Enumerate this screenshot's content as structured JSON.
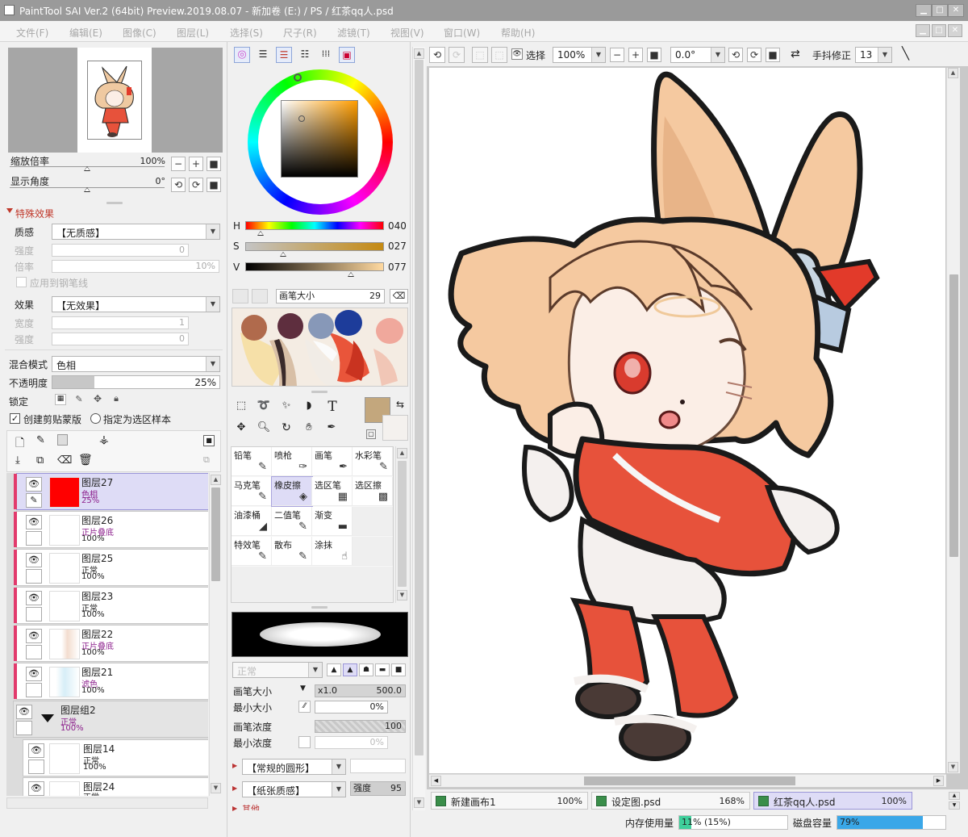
{
  "window": {
    "title": "PaintTool SAI Ver.2 (64bit) Preview.2019.08.07 - 新加卷 (E:) / PS / 红茶qq人.psd",
    "min": "▁",
    "max": "□",
    "close": "✕"
  },
  "menu": [
    "文件(F)",
    "编辑(E)",
    "图像(C)",
    "图层(L)",
    "选择(S)",
    "尺子(R)",
    "滤镜(T)",
    "视图(V)",
    "窗口(W)",
    "帮助(H)"
  ],
  "navigator": {
    "zoom_label": "缩放倍率",
    "zoom_value": "100%",
    "angle_label": "显示角度",
    "angle_value": "0°",
    "btn_minus": "−",
    "btn_plus": "+",
    "btn_reset": "■",
    "btn_rotl": "⟲",
    "btn_rotr": "⟳"
  },
  "effects": {
    "header": "特殊效果",
    "texture_label": "质感",
    "texture_value": "【无质感】",
    "strength_label": "强度",
    "strength_value": "0",
    "scale_label": "倍率",
    "scale_value": "10%",
    "apply_label": "应用到钢笔线",
    "effect_label": "效果",
    "effect_value": "【无效果】",
    "width_label": "宽度",
    "width_value": "1",
    "strength2_label": "强度",
    "strength2_value": "0"
  },
  "layer_props": {
    "blend_label": "混合模式",
    "blend_value": "色相",
    "opacity_label": "不透明度",
    "opacity_value": "25%",
    "opacity_fraction": 0.25,
    "lock_label": "锁定",
    "clip_label": "创建剪贴蒙版",
    "sample_label": "指定为选区样本"
  },
  "layers": [
    {
      "name": "图层27",
      "mode": "色相",
      "opacity": "25%",
      "selected": true,
      "thumb": "#ff0000",
      "stripe": true
    },
    {
      "name": "图层26",
      "mode": "正片叠底",
      "opacity": "100%",
      "selected": false,
      "thumb": "#ffffff",
      "stripe": true
    },
    {
      "name": "图层25",
      "mode": "正常",
      "opacity": "100%",
      "selected": false,
      "thumb": "#ffffff",
      "stripe": true
    },
    {
      "name": "图层23",
      "mode": "正常",
      "opacity": "100%",
      "selected": false,
      "thumb": "#ffffff",
      "stripe": true
    },
    {
      "name": "图层22",
      "mode": "正片叠底",
      "opacity": "100%",
      "selected": false,
      "thumb": "#f5e8df",
      "stripe": true
    },
    {
      "name": "图层21",
      "mode": "滤色",
      "opacity": "100%",
      "selected": false,
      "thumb": "#e4f4fb",
      "stripe": true
    }
  ],
  "group": {
    "name": "图层组2",
    "mode": "正常",
    "opacity": "100%"
  },
  "sub_layers": [
    {
      "name": "图层14",
      "mode": "正常",
      "opacity": "100%"
    },
    {
      "name": "图层24",
      "mode": "正常",
      "opacity": ""
    }
  ],
  "color": {
    "h_label": "H",
    "h_value": "040",
    "s_label": "S",
    "s_value": "027",
    "v_label": "V",
    "v_value": "077",
    "current": "#c3a77d",
    "brush_size_label": "画笔大小",
    "brush_size_value": "29"
  },
  "swatches": [
    {
      "c": "#b06a4c"
    },
    {
      "c": "#5e2e3e"
    },
    {
      "c": "#8798b8"
    },
    {
      "c": "#1d3c9a"
    },
    {
      "c": "#f0a89c"
    }
  ],
  "tools": [
    {
      "name": "铅笔",
      "icon": "✎",
      "selected": false
    },
    {
      "name": "喷枪",
      "icon": "✑",
      "selected": false
    },
    {
      "name": "画笔",
      "icon": "✒",
      "selected": false
    },
    {
      "name": "水彩笔",
      "icon": "✎",
      "selected": false
    },
    {
      "name": "马克笔",
      "icon": "✎",
      "selected": false
    },
    {
      "name": "橡皮擦",
      "icon": "◈",
      "selected": true
    },
    {
      "name": "选区笔",
      "icon": "▦",
      "selected": false
    },
    {
      "name": "选区擦",
      "icon": "▩",
      "selected": false
    },
    {
      "name": "油漆桶",
      "icon": "◢",
      "selected": false
    },
    {
      "name": "二值笔",
      "icon": "✎",
      "selected": false
    },
    {
      "name": "渐变",
      "icon": "▬",
      "selected": false
    },
    {
      "name": "",
      "icon": "",
      "selected": false
    },
    {
      "name": "特效笔",
      "icon": "✎",
      "selected": false
    },
    {
      "name": "散布",
      "icon": "✎",
      "selected": false
    },
    {
      "name": "涂抹",
      "icon": "☝",
      "selected": false
    },
    {
      "name": "",
      "icon": "",
      "selected": false
    }
  ],
  "brush": {
    "mode_value": "正常",
    "size_label": "画笔大小",
    "size_mult": "x1.0",
    "size_value": "500.0",
    "min_size_label": "最小大小",
    "min_size_value": "0%",
    "density_label": "画笔浓度",
    "density_value": "100",
    "min_density_label": "最小浓度",
    "min_density_value": "0%",
    "shape_value": "【常规的圆形】",
    "texture_value": "【纸张质感】",
    "strength_label": "强度",
    "strength_value": "95",
    "other_label": "其他"
  },
  "toolbar": {
    "select_label": "选择",
    "zoom_value": "100%",
    "angle_value": "0.0°",
    "stabilizer_label": "手抖修正",
    "stabilizer_value": "13"
  },
  "tabs": [
    {
      "name": "新建画布1",
      "zoom": "100%",
      "active": false
    },
    {
      "name": "设定图.psd",
      "zoom": "168%",
      "active": false
    },
    {
      "name": "红茶qq人.psd",
      "zoom": "100%",
      "active": true
    }
  ],
  "status": {
    "mem_label": "内存使用量",
    "mem_value": "11% (15%)",
    "mem_fraction": 0.11,
    "disk_label": "磁盘容量",
    "disk_value": "79%",
    "disk_fraction": 0.79
  },
  "colors": {
    "selection": "#dedcf6",
    "stripe": "#e23a6c",
    "blend_purple": "#8c1f8c",
    "mem_bar": "#3ecf9b",
    "disk_bar": "#3aa7e8"
  }
}
